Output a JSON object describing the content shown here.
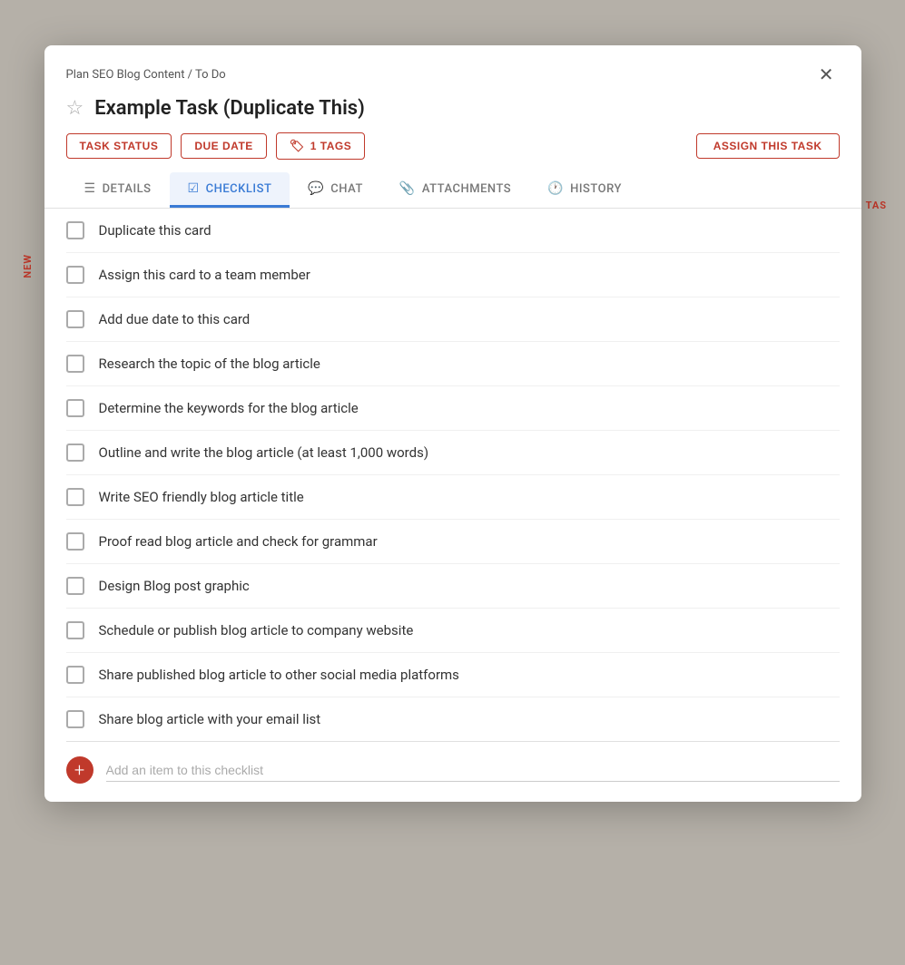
{
  "breadcrumb": "Plan SEO Blog Content / To Do",
  "close_label": "✕",
  "task_title": "Example Task (Duplicate This)",
  "star_icon": "☆",
  "buttons": {
    "task_status": "TASK STATUS",
    "due_date": "DUE DATE",
    "tags": "1 TAGS",
    "assign": "ASSIGN THIS TASK"
  },
  "tabs": [
    {
      "id": "details",
      "label": "DETAILS",
      "icon": "≡"
    },
    {
      "id": "checklist",
      "label": "CHECKLIST",
      "icon": "✓",
      "active": true
    },
    {
      "id": "chat",
      "label": "CHAT",
      "icon": "💬"
    },
    {
      "id": "attachments",
      "label": "ATTACHMENTS",
      "icon": "📎"
    },
    {
      "id": "history",
      "label": "HISTORY",
      "icon": "🕐"
    }
  ],
  "checklist_items": [
    "Duplicate this card",
    "Assign this card to a team member",
    "Add due date to this card",
    "Research the topic of the blog article",
    "Determine the keywords for the blog article",
    "Outline and write the blog article (at least 1,000 words)",
    "Write SEO friendly blog article title",
    "Proof read blog article and check for grammar",
    "Design Blog post graphic",
    "Schedule or publish blog article to company website",
    "Share published blog article to other social media platforms",
    "Share blog article with your email list"
  ],
  "add_placeholder": "Add an item to this checklist",
  "bg": {
    "new_label": "NEW",
    "tas_label": "TAS"
  }
}
